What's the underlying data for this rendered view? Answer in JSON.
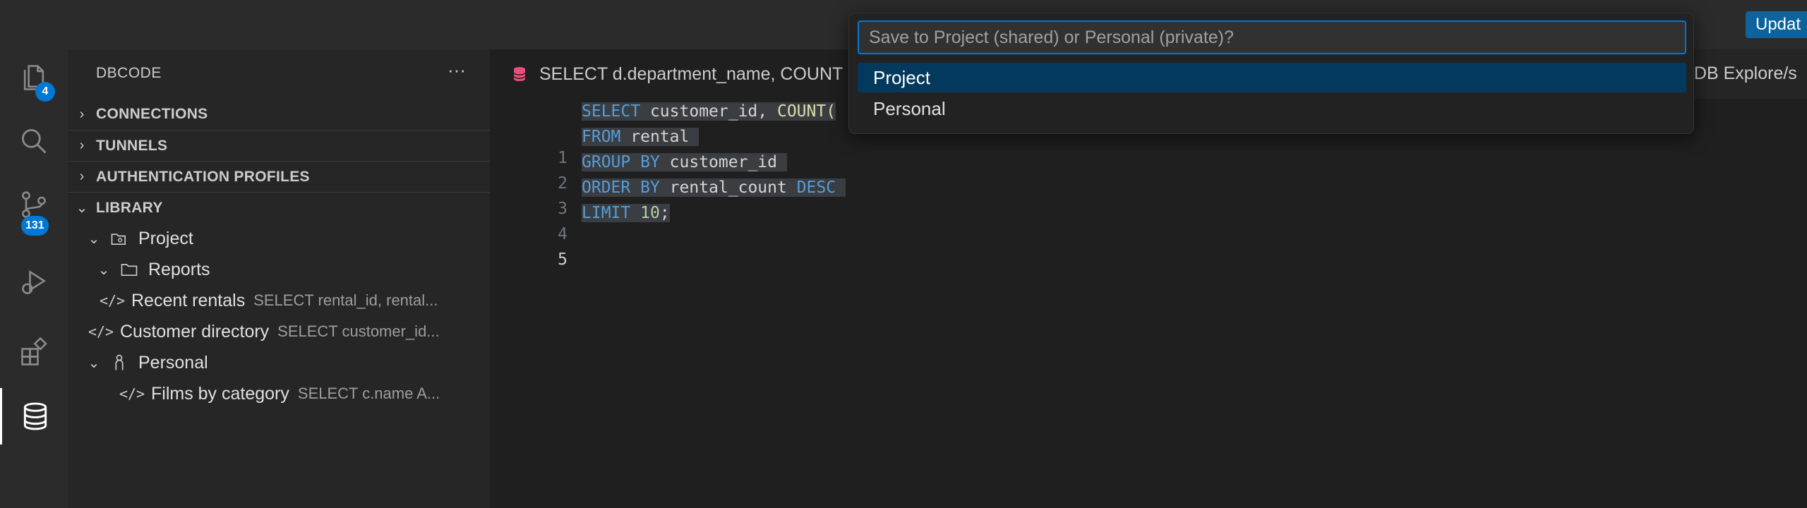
{
  "titlebar": {
    "update_label": "Updat"
  },
  "activity": {
    "explorer_badge": "4",
    "scm_badge": "131"
  },
  "sidebar": {
    "title": "DBCODE",
    "more": "···",
    "sections": {
      "connections": "CONNECTIONS",
      "tunnels": "TUNNELS",
      "auth": "AUTHENTICATION PROFILES",
      "library": "LIBRARY"
    },
    "tree": {
      "project": "Project",
      "reports": "Reports",
      "recent_rentals": {
        "name": "Recent rentals",
        "desc": "SELECT rental_id, rental..."
      },
      "customer_directory": {
        "name": "Customer directory",
        "desc": "SELECT customer_id..."
      },
      "personal": "Personal",
      "films_by_category": {
        "name": "Films by category",
        "desc": "SELECT c.name A..."
      }
    },
    "code_glyph": "</>"
  },
  "editor": {
    "tab_label": "SELECT d.department_name, COUNT",
    "breadcrumb": "aDB Explore/s",
    "line_numbers": [
      "1",
      "2",
      "3",
      "4",
      "5"
    ],
    "code": {
      "l1": {
        "kw1": "SELECT",
        "id1": "customer_id,",
        "fn1": "COUNT("
      },
      "l2": {
        "kw1": "FROM",
        "id1": "rental"
      },
      "l3": {
        "kw1": "GROUP",
        "kw2": "BY",
        "id1": "customer_id"
      },
      "l4": {
        "kw1": "ORDER",
        "kw2": "BY",
        "id1": "rental_count",
        "kw3": "DESC"
      },
      "l5": {
        "kw1": "LIMIT",
        "num1": "10",
        "pn1": ";"
      }
    }
  },
  "quickpick": {
    "placeholder": "Save to Project (shared) or Personal (private)?",
    "items": [
      "Project",
      "Personal"
    ]
  },
  "colors": {
    "accent": "#0078d4",
    "selection": "#04395e",
    "keyword": "#569cd6",
    "function": "#dcdcaa"
  }
}
